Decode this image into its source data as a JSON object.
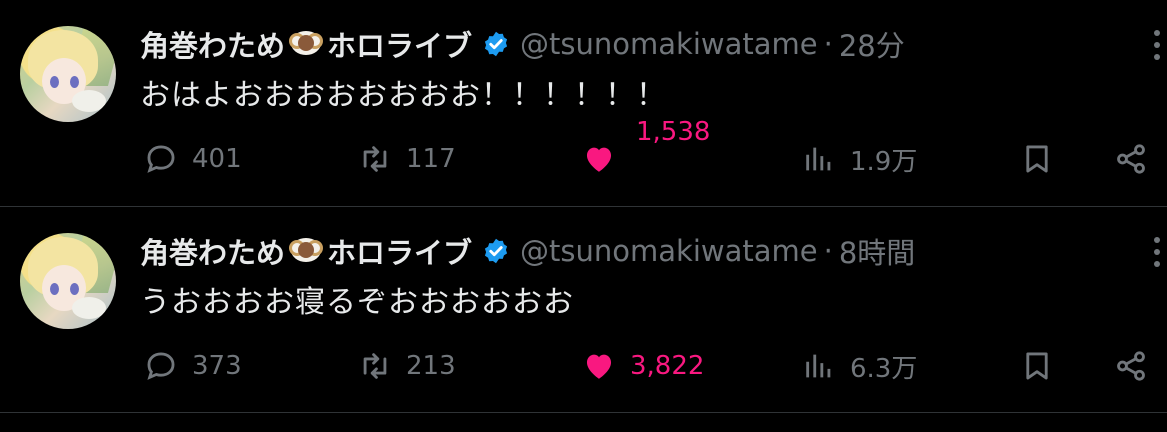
{
  "colors": {
    "background": "#000000",
    "text": "#e7e9ea",
    "muted": "#71767b",
    "like": "#f91880",
    "verified": "#1d9bf0"
  },
  "tweets": [
    {
      "name": "角巻わため",
      "name_suffix": "ホロライブ",
      "handle": "@tsunomakiwatame",
      "time": "28分",
      "text": "おはよおおおおおおおお！！！！！！",
      "replies": "401",
      "retweets": "117",
      "likes": "1,538",
      "views": "1.9万",
      "liked": true
    },
    {
      "name": "角巻わため",
      "name_suffix": "ホロライブ",
      "handle": "@tsunomakiwatame",
      "time": "8時間",
      "text": "うおおおお寝るぞおおおおおお",
      "replies": "373",
      "retweets": "213",
      "likes": "3,822",
      "views": "6.3万",
      "liked": true
    }
  ],
  "icons": [
    "avatar",
    "sheep-emoji",
    "verified-badge-icon",
    "more-icon",
    "reply-icon",
    "retweet-icon",
    "heart-icon",
    "views-icon",
    "bookmark-icon",
    "share-icon"
  ]
}
